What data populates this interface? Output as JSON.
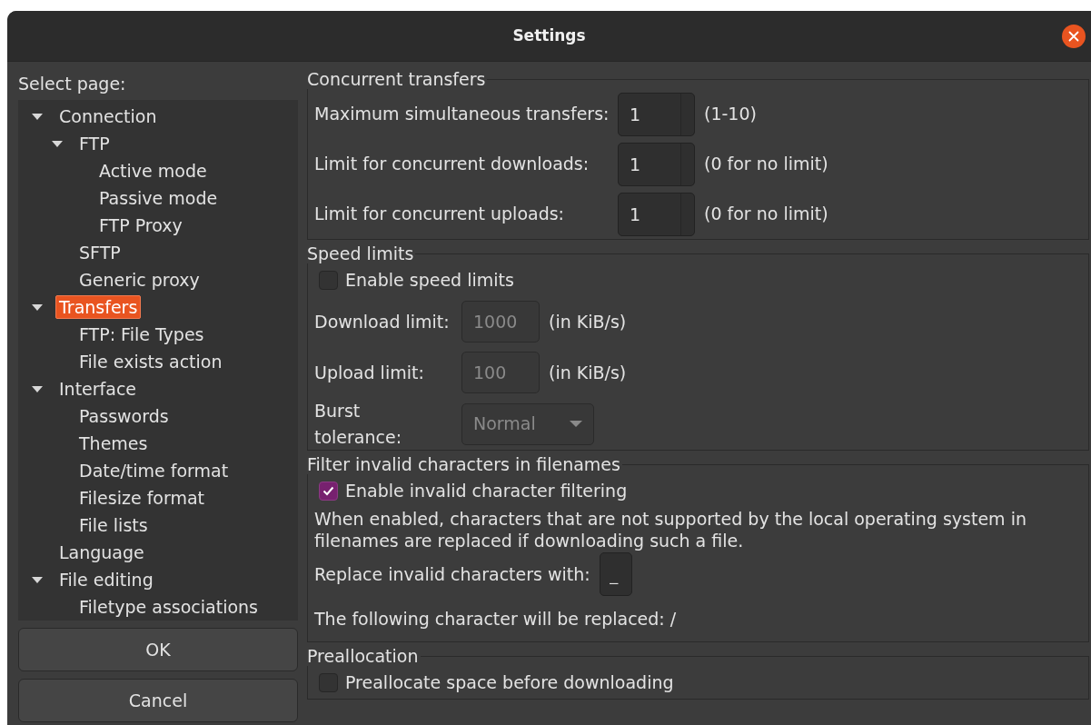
{
  "window": {
    "title": "Settings"
  },
  "sidebar": {
    "label": "Select page:",
    "tree": [
      {
        "label": "Connection",
        "expanded": true,
        "selected": false,
        "children": [
          {
            "label": "FTP",
            "expanded": true,
            "selected": false,
            "children": [
              {
                "label": "Active mode",
                "selected": false
              },
              {
                "label": "Passive mode",
                "selected": false
              },
              {
                "label": "FTP Proxy",
                "selected": false
              }
            ]
          },
          {
            "label": "SFTP",
            "selected": false
          },
          {
            "label": "Generic proxy",
            "selected": false
          }
        ]
      },
      {
        "label": "Transfers",
        "expanded": true,
        "selected": true,
        "children": [
          {
            "label": "FTP: File Types",
            "selected": false
          },
          {
            "label": "File exists action",
            "selected": false
          }
        ]
      },
      {
        "label": "Interface",
        "expanded": true,
        "selected": false,
        "children": [
          {
            "label": "Passwords",
            "selected": false
          },
          {
            "label": "Themes",
            "selected": false
          },
          {
            "label": "Date/time format",
            "selected": false
          },
          {
            "label": "Filesize format",
            "selected": false
          },
          {
            "label": "File lists",
            "selected": false
          }
        ]
      },
      {
        "label": "Language",
        "selected": false
      },
      {
        "label": "File editing",
        "expanded": true,
        "selected": false,
        "children": [
          {
            "label": "Filetype associations",
            "selected": false
          }
        ]
      }
    ]
  },
  "buttons": [
    {
      "label": "OK"
    },
    {
      "label": "Cancel"
    }
  ],
  "groups": [
    {
      "title": "Concurrent transfers",
      "rows": [
        {
          "kind": "spin",
          "label": "Maximum simultaneous transfers:",
          "value": "1",
          "hint": "(1-10)"
        },
        {
          "kind": "spin",
          "label": "Limit for concurrent downloads:",
          "value": "1",
          "hint": "(0 for no limit)"
        },
        {
          "kind": "spin",
          "label": "Limit for concurrent uploads:",
          "value": "1",
          "hint": "(0 for no limit)"
        }
      ]
    },
    {
      "title": "Speed limits",
      "rows": [
        {
          "kind": "checkbox",
          "label": "Enable speed limits",
          "checked": false
        },
        {
          "kind": "field",
          "label": "Download limit:",
          "value": "1000",
          "disabled": true,
          "hint": "(in KiB/s)"
        },
        {
          "kind": "field",
          "label": "Upload limit:",
          "value": "100",
          "disabled": true,
          "hint": "(in KiB/s)"
        },
        {
          "kind": "select",
          "label": "Burst tolerance:",
          "value": "Normal",
          "disabled": true
        }
      ]
    },
    {
      "title": "Filter invalid characters in filenames",
      "rows": [
        {
          "kind": "checkbox",
          "label": "Enable invalid character filtering",
          "checked": true
        },
        {
          "kind": "text",
          "text": "When enabled, characters that are not supported by the local operating system in filenames are replaced if downloading such a file."
        },
        {
          "kind": "char",
          "label": "Replace invalid characters with:",
          "value": "_"
        },
        {
          "kind": "text",
          "text": "The following character will be replaced: /"
        }
      ]
    },
    {
      "title": "Preallocation",
      "rows": [
        {
          "kind": "checkbox",
          "label": "Preallocate space before downloading",
          "checked": false
        }
      ]
    }
  ]
}
